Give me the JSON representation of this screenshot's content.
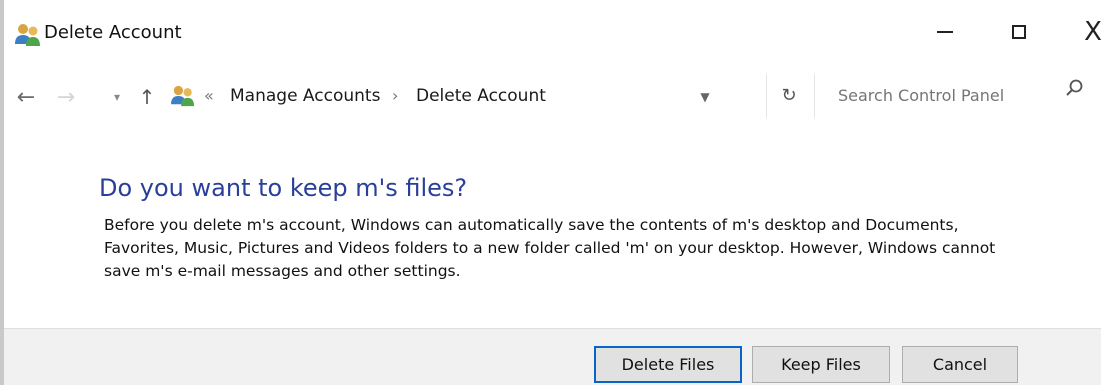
{
  "window": {
    "title": "Delete Account",
    "icon": "users-icon",
    "controls": {
      "minimize_icon": "minimize-icon",
      "maximize_icon": "maximize-icon",
      "close_label": "X"
    }
  },
  "navigation": {
    "back_icon": "back-arrow-icon",
    "forward_icon": "forward-arrow-icon",
    "recent_icon": "chevron-down-icon",
    "up_icon": "up-arrow-icon",
    "address": {
      "overflow_label": "«",
      "breadcrumb": [
        "Manage Accounts",
        "Delete Account"
      ],
      "separator": "›",
      "dropdown_icon": "chevron-down-icon"
    },
    "refresh_icon": "refresh-icon",
    "search": {
      "placeholder": "Search Control Panel",
      "icon": "search-icon"
    }
  },
  "content": {
    "heading": "Do you want to keep m's files?",
    "body": "Before you delete m's account, Windows can automatically save the contents of m's desktop and Documents, Favorites, Music, Pictures and Videos folders to a new folder called 'm' on your desktop. However, Windows cannot save m's e-mail messages and other settings."
  },
  "footer": {
    "buttons": {
      "delete_files": "Delete Files",
      "keep_files": "Keep Files",
      "cancel": "Cancel"
    }
  },
  "colors": {
    "heading": "#2a3f9a",
    "default_button_border": "#0a64c8",
    "footer_background": "#f1f1f1"
  }
}
